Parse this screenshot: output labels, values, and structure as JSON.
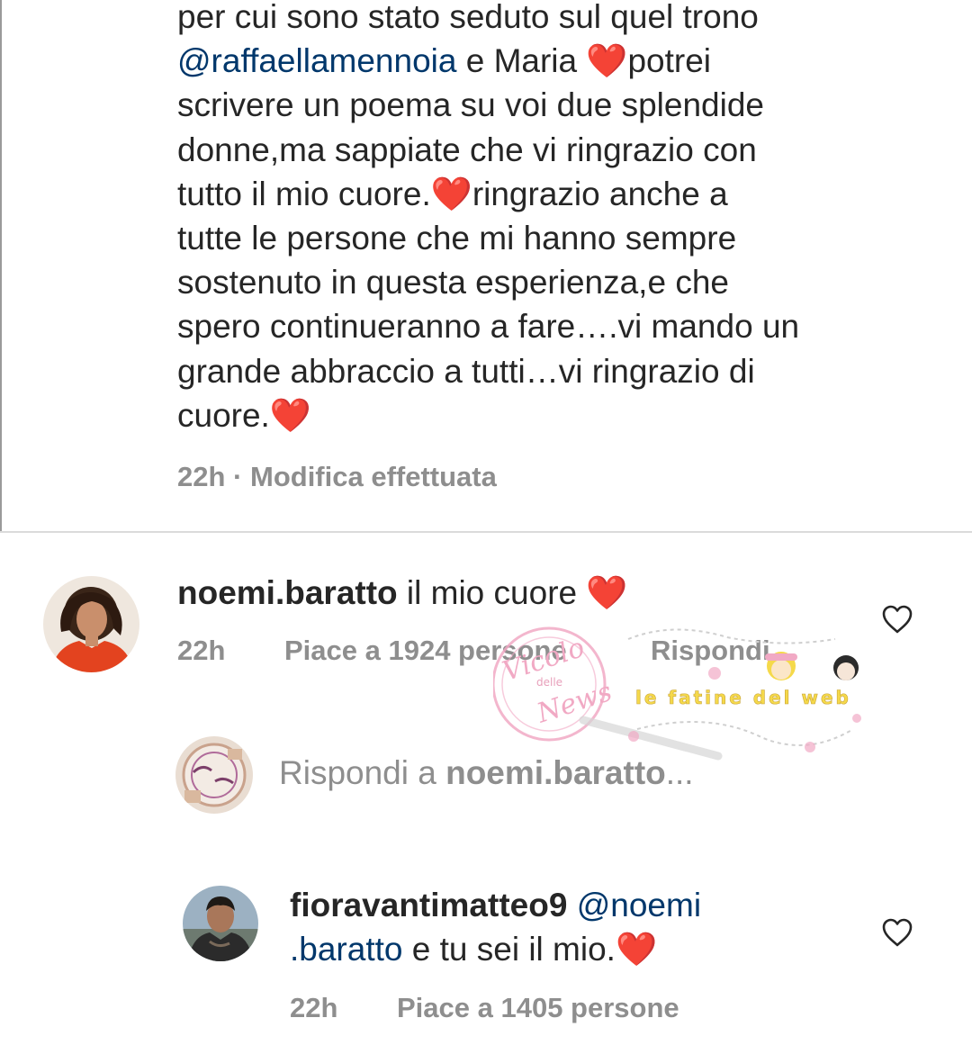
{
  "post": {
    "caption_lines": [
      [
        "per cui sono stato seduto sul quel trono"
      ],
      [
        "@raffaellamennoia",
        " e Maria ",
        "❤️",
        "potrei"
      ],
      [
        "scrivere un poema su voi due splendide"
      ],
      [
        "donne,ma sappiate che vi ringrazio con"
      ],
      [
        "tutto il mio cuore.",
        "❤️",
        "ringrazio anche a"
      ],
      [
        "tutte le persone che mi hanno sempre"
      ],
      [
        "sostenuto in questa esperienza,e che"
      ],
      [
        "spero continueranno a fare….vi mando un"
      ],
      [
        "grande abbraccio a tutti…vi ringrazio di"
      ],
      [
        "cuore.",
        "❤️"
      ]
    ],
    "time": "22h",
    "separator": "·",
    "edited_label": "Modifica effettuata"
  },
  "comment": {
    "username": "noemi.baratto",
    "text": "il mio cuore",
    "emoji": "❤️",
    "time": "22h",
    "likes": "Piace a 1924 persone",
    "reply_label": "Rispondi",
    "like_icon": "heart-outline-icon"
  },
  "reply_composer": {
    "prefix": "Rispondi a ",
    "target": "noemi.baratto",
    "suffix": "..."
  },
  "reply": {
    "username": "fioravantimatteo9",
    "mention_part1": "@noemi",
    "mention_part2": ".baratto",
    "text": " e tu sei il mio.",
    "emoji": "❤️",
    "time": "22h",
    "likes": "Piace a 1405 persone",
    "like_icon": "heart-outline-icon"
  },
  "watermark": {
    "logo_lines": [
      "Vicolo",
      "delle",
      "News"
    ],
    "secondary_text": "le fatine del web"
  },
  "colors": {
    "text": "#262626",
    "muted": "#8e8e8e",
    "mention": "#00376b",
    "heart": "#e0142e",
    "divider": "#dbdbdb",
    "watermark_pink": "#f1a9c4",
    "watermark_yellow": "#f5d94a"
  }
}
